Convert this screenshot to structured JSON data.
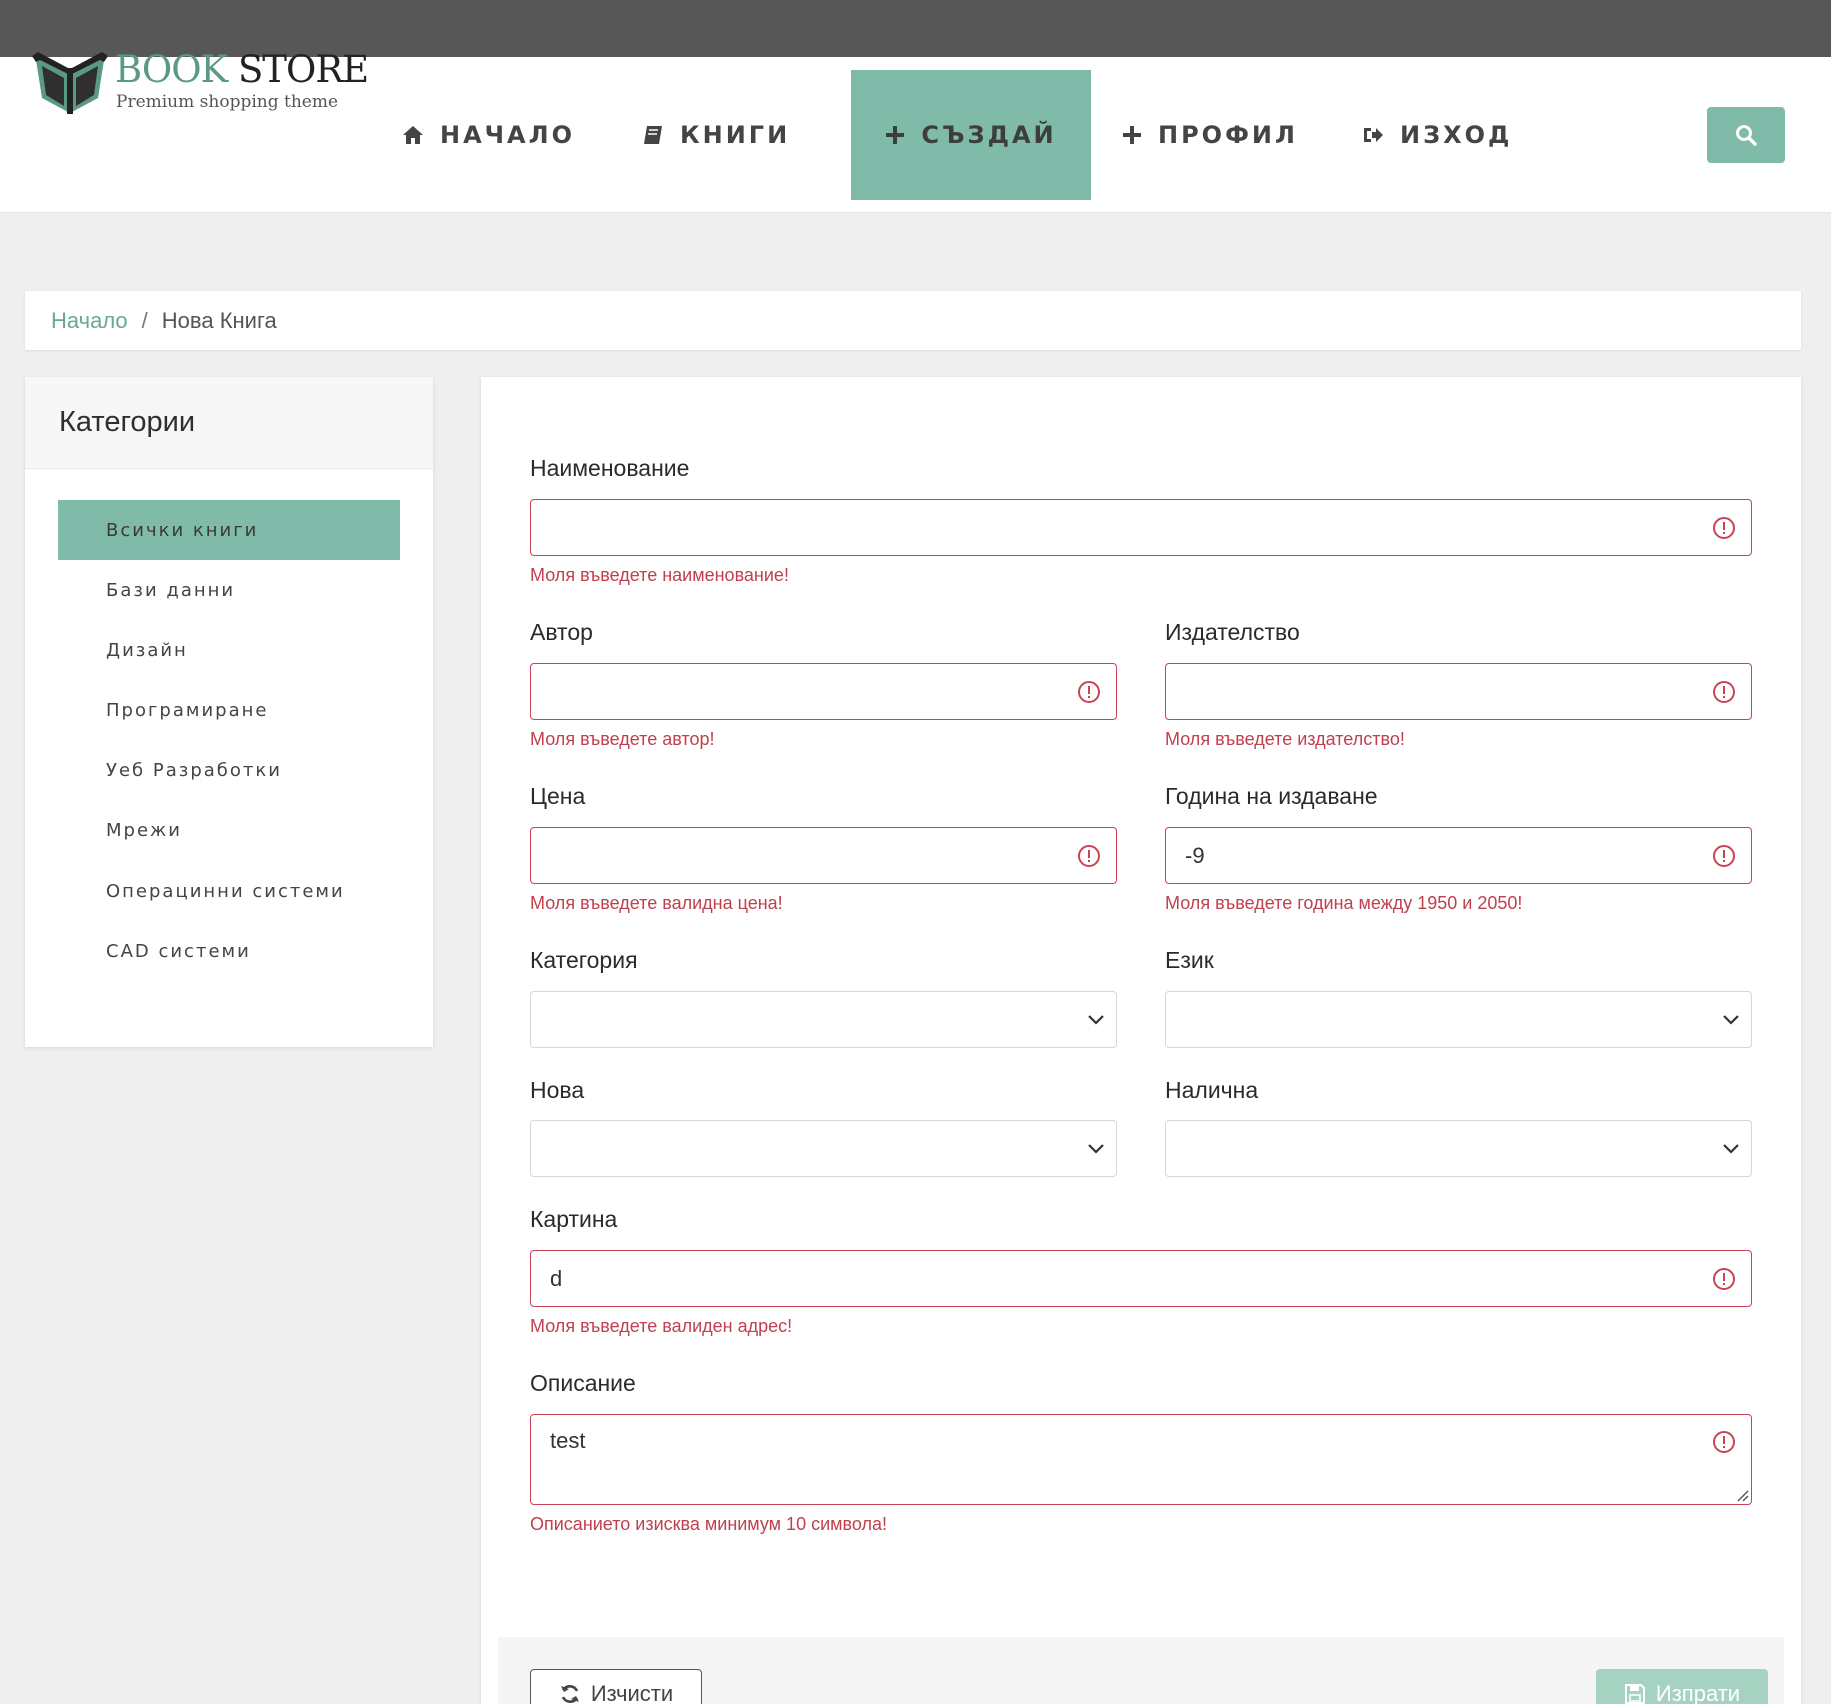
{
  "header": {
    "logo_title_part1": "BOOK",
    "logo_title_part2": "STORE",
    "logo_subtitle": "Premium shopping theme",
    "nav": [
      {
        "label": "НАЧАЛО",
        "icon": "home-icon"
      },
      {
        "label": "КНИГИ",
        "icon": "book-icon"
      },
      {
        "label": "СЪЗДАЙ",
        "icon": "plus-icon",
        "active": true
      },
      {
        "label": "ПРОФИЛ",
        "icon": "plus-icon"
      },
      {
        "label": "ИЗХОД",
        "icon": "sign-out-icon"
      }
    ],
    "search_icon": "search-icon"
  },
  "breadcrumb": {
    "home": "Начало",
    "separator": "/",
    "current": "Нова Книга"
  },
  "sidebar": {
    "title": "Категории",
    "items": [
      {
        "label": "Всички книги",
        "active": true
      },
      {
        "label": "Бази данни"
      },
      {
        "label": "Дизайн"
      },
      {
        "label": "Програмиране"
      },
      {
        "label": "Уеб Разработки"
      },
      {
        "label": "Мрежи"
      },
      {
        "label": "Операцинни системи"
      },
      {
        "label": "CAD системи"
      }
    ]
  },
  "form": {
    "name": {
      "label": "Наименование",
      "value": "",
      "error": "Моля въведете наименование!"
    },
    "author": {
      "label": "Автор",
      "value": "",
      "error": "Моля въведете автор!"
    },
    "publisher": {
      "label": "Издателство",
      "value": "",
      "error": "Моля въведете издателство!"
    },
    "price": {
      "label": "Цена",
      "value": "",
      "error": "Моля въведете валидна цена!"
    },
    "year": {
      "label": "Година на издаване",
      "value": "-9",
      "error": "Моля въведете година между 1950 и 2050!"
    },
    "category": {
      "label": "Категория",
      "selected": ""
    },
    "language": {
      "label": "Език",
      "selected": ""
    },
    "is_new": {
      "label": "Нова",
      "selected": ""
    },
    "available": {
      "label": "Налична",
      "selected": ""
    },
    "image": {
      "label": "Картина",
      "value": "d",
      "error": "Моля въведете валиден адрес!"
    },
    "description": {
      "label": "Описание",
      "value": "test",
      "error": "Описанието изисква минимум 10 символа!"
    },
    "clear_button": "Изчисти",
    "submit_button": "Изпрати"
  },
  "colors": {
    "accent": "#7fbba8",
    "error": "#c94452",
    "topbar": "#575757"
  }
}
